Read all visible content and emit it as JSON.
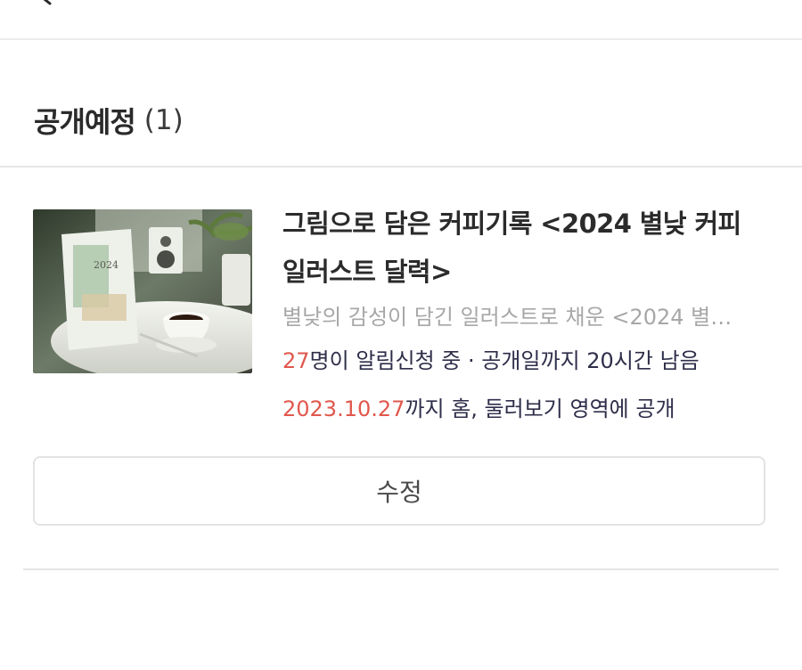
{
  "section": {
    "title": "공개예정",
    "count": "(1)"
  },
  "card": {
    "thumbnail_alt": "2024",
    "title": "그림으로 담은 커피기록 <2024 별낮 커피 일러스트 달력>",
    "description": "별낮의 감성이 담긴 일러스트로 채운 <2024 별…",
    "subscribers_count": "27",
    "subscribers_suffix": "명이 알림신청 중 · 공개일까지 20시간 남음",
    "publish_date": "2023.10.27",
    "publish_suffix": "까지 홈, 둘러보기 영역에 공개",
    "edit_label": "수정"
  },
  "colors": {
    "accent": "#e0574c",
    "meta_text": "#2e2e4a",
    "divider": "#e6e6e6"
  },
  "icons": {
    "back": "back-arrow-icon"
  }
}
